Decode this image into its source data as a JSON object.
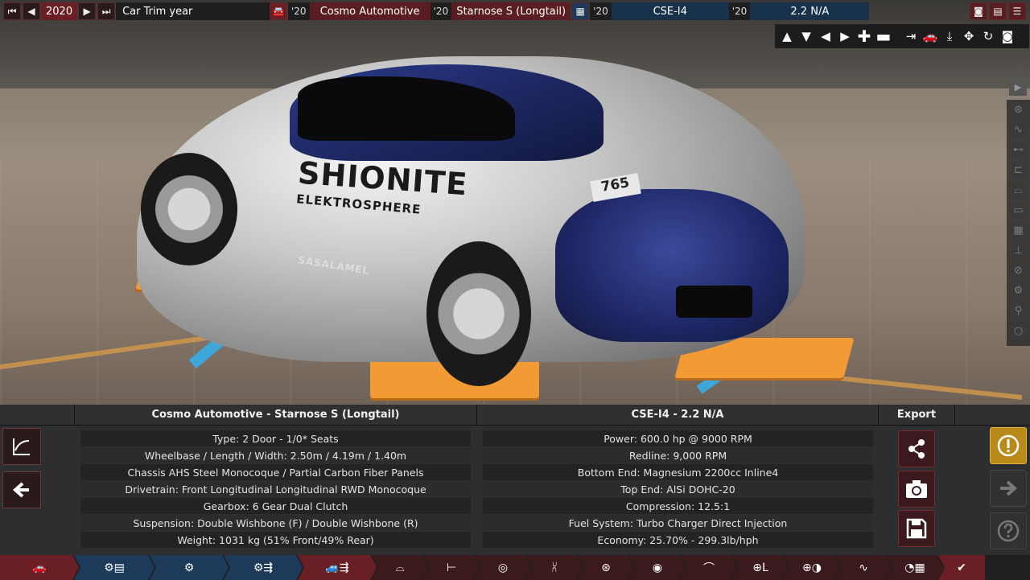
{
  "topbar": {
    "year": "2020",
    "mode_label": "Car Trim year",
    "model_year_short": "'20",
    "company": "Cosmo Automotive",
    "trim_year_short": "'20",
    "trim": "Starnose S (Longtail)",
    "engine_year_short": "'20",
    "engine_family": "CSE-I4",
    "variant_year_short": "'20",
    "variant": "2.2 N/A"
  },
  "scene": {
    "decals": {
      "brand": "SHIONITE",
      "sub": "ELEKTROSPHERE",
      "side": "SASALAMEL",
      "race_number": "765"
    }
  },
  "car_panel": {
    "title": "Cosmo Automotive - Starnose S (Longtail)",
    "rows": [
      "Type: 2 Door - 1/0* Seats",
      "Wheelbase / Length / Width: 2.50m / 4.19m / 1.40m",
      "Chassis AHS Steel Monocoque / Partial Carbon Fiber Panels",
      "Drivetrain: Front Longitudinal Longitudinal RWD Monocoque",
      "Gearbox: 6 Gear Dual Clutch",
      "Suspension: Double Wishbone (F) / Double Wishbone (R)",
      "Weight: 1031 kg (51% Front/49% Rear)"
    ]
  },
  "engine_panel": {
    "title": "CSE-I4 - 2.2 N/A",
    "rows": [
      "Power: 600.0 hp @ 9000 RPM",
      "Redline:  9,000 RPM",
      "Bottom End: Magnesium 2200cc Inline4",
      "Top End: AlSi DOHC-20",
      "Compression: 12.5:1",
      "Fuel System: Turbo Charger Direct Injection",
      "Economy: 25.70% - 299.3lb/hph"
    ]
  },
  "export_panel": {
    "title": "Export"
  },
  "colors": {
    "accent": "#6a1f24",
    "engine_slot": "#17324a",
    "warning": "#b98a1a"
  }
}
